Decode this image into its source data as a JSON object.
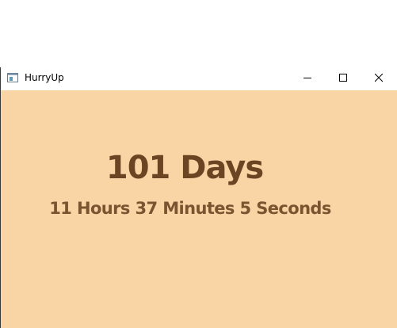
{
  "window": {
    "title": "HurryUp",
    "controls": {
      "minimize_icon": "minimize-icon",
      "maximize_icon": "maximize-icon",
      "close_icon": "close-icon"
    }
  },
  "countdown": {
    "days": "101 Days",
    "remainder": "11 Hours 37 Minutes 5 Seconds"
  },
  "colors": {
    "background": "#f9d5a6",
    "days_text": "#6b4423",
    "remainder_text": "#7a5430"
  }
}
